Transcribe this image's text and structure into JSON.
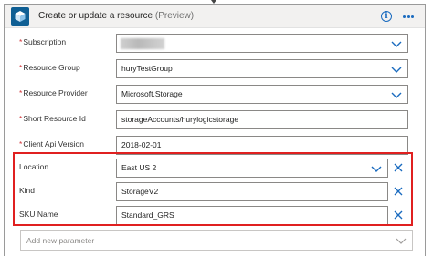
{
  "header": {
    "title": "Create or update a resource",
    "subtitle": "(Preview)",
    "info_icon": "info-icon",
    "more_icon": "more-options-icon",
    "app_icon": "azure-resource-cube-icon"
  },
  "required_fields": [
    {
      "label": "Subscription",
      "value": "",
      "type": "dropdown",
      "redacted": true
    },
    {
      "label": "Resource Group",
      "value": "huryTestGroup",
      "type": "dropdown"
    },
    {
      "label": "Resource Provider",
      "value": "Microsoft.Storage",
      "type": "dropdown"
    },
    {
      "label": "Short Resource Id",
      "value": "storageAccounts/hurylogicstorage",
      "type": "text"
    },
    {
      "label": "Client Api Version",
      "value": "2018-02-01",
      "type": "text"
    }
  ],
  "optional_fields": [
    {
      "label": "Location",
      "value": "East US 2",
      "type": "dropdown"
    },
    {
      "label": "Kind",
      "value": "StorageV2",
      "type": "text"
    },
    {
      "label": "SKU Name",
      "value": "Standard_GRS",
      "type": "text"
    }
  ],
  "add_parameter": {
    "placeholder": "Add new parameter"
  },
  "colors": {
    "accent": "#1a6bbf",
    "highlight": "#e02020",
    "required": "#d13438",
    "header_bg": "#f2f1f0"
  }
}
